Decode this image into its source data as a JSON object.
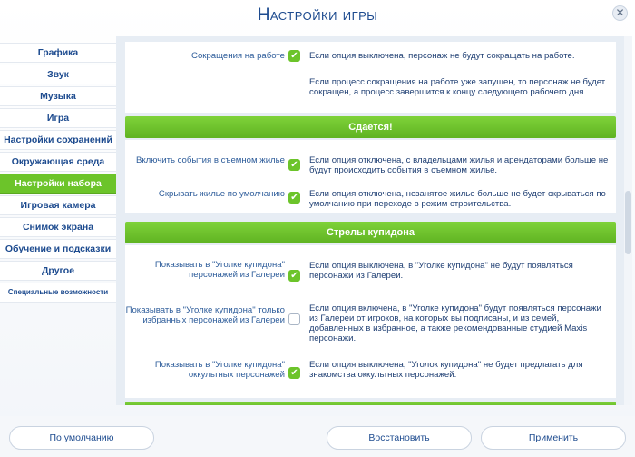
{
  "header": {
    "title": "Настройки игры",
    "close_glyph": "✕"
  },
  "sidebar": {
    "items": [
      {
        "label": "Графика"
      },
      {
        "label": "Звук"
      },
      {
        "label": "Музыка"
      },
      {
        "label": "Игра"
      },
      {
        "label": "Настройки сохранений"
      },
      {
        "label": "Окружающая среда"
      },
      {
        "label": "Настройки набора",
        "active": true
      },
      {
        "label": "Игровая камера"
      },
      {
        "label": "Снимок экрана"
      },
      {
        "label": "Обучение и подсказки"
      },
      {
        "label": "Другое"
      },
      {
        "label": "Специальные возможности"
      }
    ]
  },
  "content": {
    "work": {
      "label": "Сокращения на работе",
      "desc": "Если опция выключена, персонаж не будут сокращать на работе.",
      "extra": "Если процесс сокращения на работе уже запущен, то персонаж не будет сокращен, а процесс завершится к концу следующего рабочего дня."
    },
    "section_rent": {
      "title": "Сдается!"
    },
    "rent_events": {
      "label": "Включить события в съемном жилье",
      "desc": "Если опция отключена, с владельцами жилья и арендаторами больше не будут происходить события в съемном жилье."
    },
    "hide_rent": {
      "label": "Скрывать жилье по умолчанию",
      "desc": "Если опция отключена, незанятое жилье больше не будет скрываться по умолчанию при переходе в режим строительства."
    },
    "section_cupid": {
      "title": "Стрелы купидона"
    },
    "cupid_gallery": {
      "label": "Показывать в \"Уголке купидона\" персонажей из Галереи",
      "desc": "Если опция выключена, в \"Уголке купидона\" не будут появляться персонажи из Галереи."
    },
    "cupid_favorites": {
      "label": "Показывать в \"Уголке купидона\" только избранных персонажей из Галереи",
      "desc": "Если опция включена, в \"Уголке купидона\" будут появляться персонажи из Галереи от игроков, на которых вы подписаны, и из семей, добавленных в избранное, а также рекомендованные студией Maxis персонажи."
    },
    "cupid_occult": {
      "label": "Показывать в \"Уголке купидона\" оккультных персонажей",
      "desc": "Если опция выключена, \"Уголок купидона\" не будет предлагать для знакомства оккультных персонажей."
    },
    "check_glyph": "✔"
  },
  "footer": {
    "default_label": "По умолчанию",
    "restore_label": "Восстановить",
    "apply_label": "Применить"
  },
  "colors": {
    "accent": "#6cc42a",
    "text": "#1d4b8f",
    "panel": "#e7edf4"
  }
}
